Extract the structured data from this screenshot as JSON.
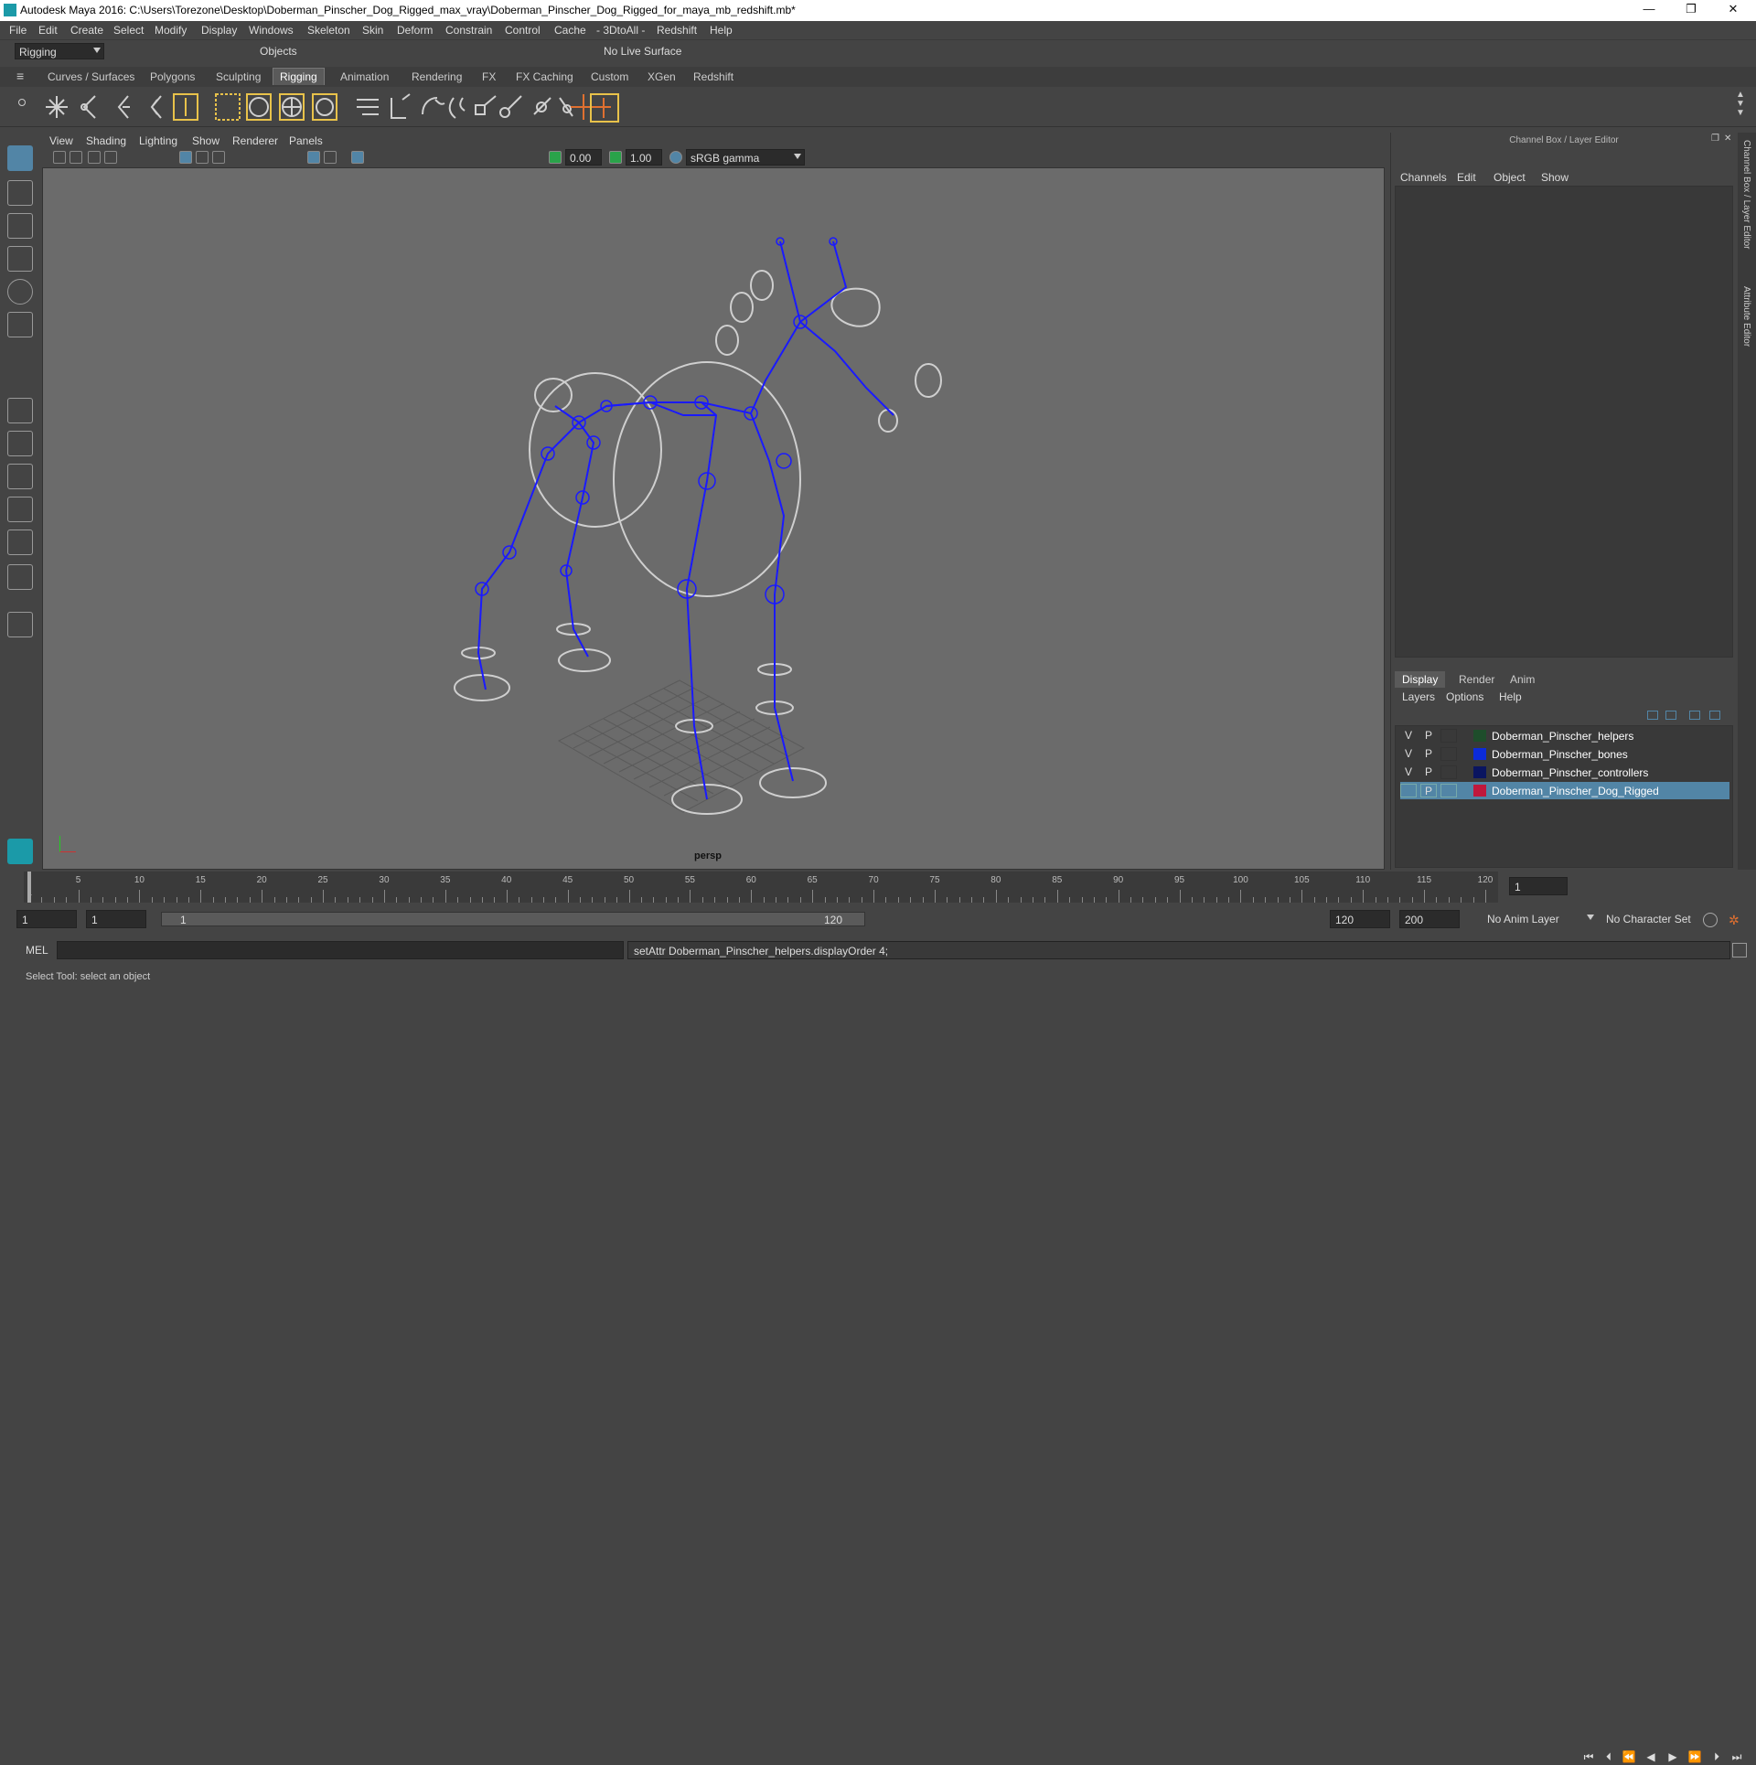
{
  "app": {
    "title": "Autodesk Maya 2016: C:\\Users\\Torezone\\Desktop\\Doberman_Pinscher_Dog_Rigged_max_vray\\Doberman_Pinscher_Dog_Rigged_for_maya_mb_redshift.mb*",
    "window_buttons": [
      "—",
      "❐",
      "✕"
    ]
  },
  "menubar": [
    "File",
    "Edit",
    "Create",
    "Select",
    "Modify",
    "Display",
    "Windows",
    "Skeleton",
    "Skin",
    "Deform",
    "Constrain",
    "Control",
    "Cache",
    "- 3DtoAll -",
    "Redshift",
    "Help"
  ],
  "statusline": {
    "mode": "Rigging",
    "selection_mode": "Objects",
    "live_surface": "No Live Surface"
  },
  "shelf_tabs": [
    "Curves / Surfaces",
    "Polygons",
    "Sculpting",
    "Rigging",
    "Animation",
    "Rendering",
    "FX",
    "FX Caching",
    "Custom",
    "XGen",
    "Redshift"
  ],
  "active_shelf_tab": "Rigging",
  "panel": {
    "menu": [
      "View",
      "Shading",
      "Lighting",
      "Show",
      "Renderer",
      "Panels"
    ],
    "exposure": "0.00",
    "gamma": "1.00",
    "colorspace": "sRGB gamma",
    "camera_label": "persp"
  },
  "channel_box": {
    "title": "Channel Box / Layer Editor",
    "menu": [
      "Channels",
      "Edit",
      "Object",
      "Show"
    ],
    "layer_tabs": [
      "Display",
      "Render",
      "Anim"
    ],
    "active_layer_tab": "Display",
    "layer_menu": [
      "Layers",
      "Options",
      "Help"
    ],
    "layers": [
      {
        "v": "V",
        "p": "P",
        "name": "Doberman_Pinscher_helpers",
        "color": "#1e4d2b",
        "selected": false
      },
      {
        "v": "V",
        "p": "P",
        "name": "Doberman_Pinscher_bones",
        "color": "#0b2bd9",
        "selected": false
      },
      {
        "v": "V",
        "p": "P",
        "name": "Doberman_Pinscher_controllers",
        "color": "#0a1560",
        "selected": false
      },
      {
        "v": "",
        "p": "P",
        "name": "Doberman_Pinscher_Dog_Rigged",
        "color": "#c0183c",
        "selected": true
      }
    ],
    "side_tabs": [
      "Channel Box / Layer Editor",
      "Attribute Editor"
    ]
  },
  "timeline": {
    "ticks": [
      1,
      5,
      10,
      15,
      20,
      25,
      30,
      35,
      40,
      45,
      50,
      55,
      60,
      65,
      70,
      75,
      80,
      85,
      90,
      95,
      100,
      105,
      110,
      115,
      120
    ],
    "current_frame": "1"
  },
  "range": {
    "start": "1",
    "playback_start": "1",
    "slider_start": "1",
    "slider_end": "120",
    "playback_end": "120",
    "end": "200",
    "anim_layer": "No Anim Layer",
    "character_set": "No Character Set"
  },
  "command": {
    "lang": "MEL",
    "result": "setAttr Doberman_Pinscher_helpers.displayOrder 4;"
  },
  "help_line": "Select Tool: select an object",
  "colors": {
    "bones": "#1a1aff",
    "controller": "#c8c8c8",
    "selection": "#5285a6"
  }
}
